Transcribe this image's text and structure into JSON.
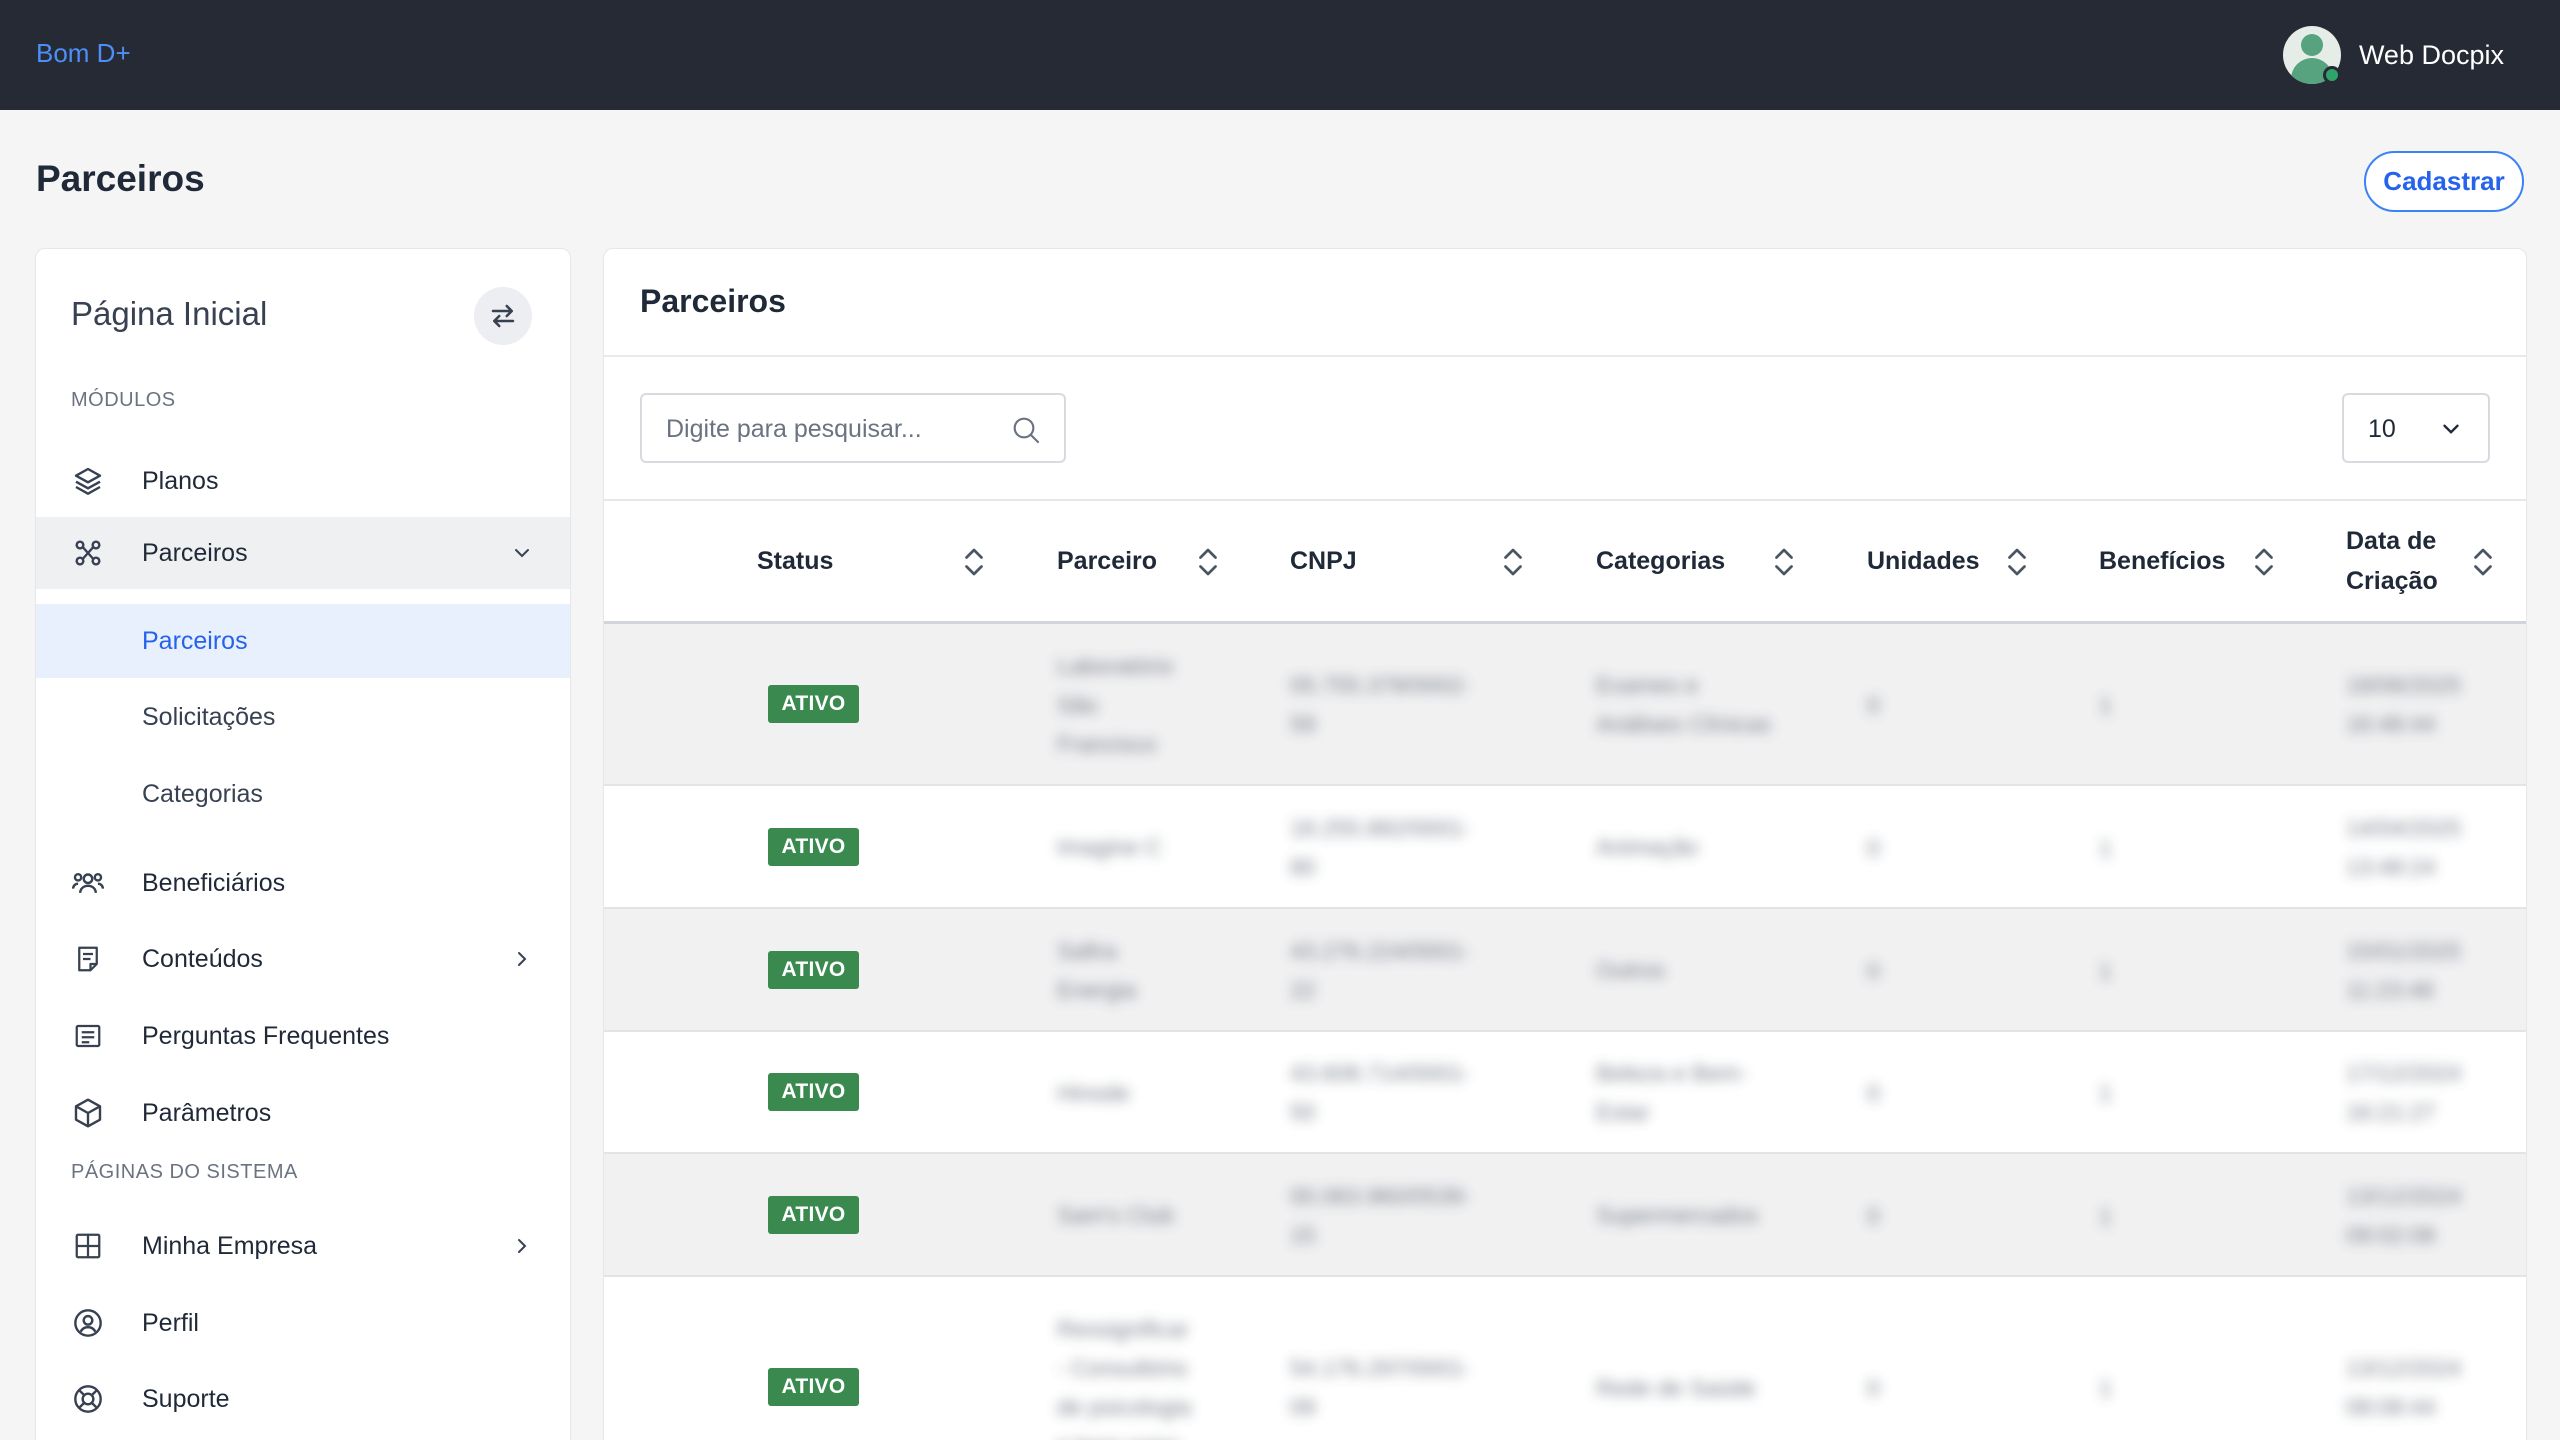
{
  "topbar": {
    "brand": "Bom D+",
    "user_name": "Web Docpix"
  },
  "page": {
    "title": "Parceiros",
    "cadastrar_label": "Cadastrar"
  },
  "sidebar": {
    "title": "Página Inicial",
    "section_modules": "MÓDULOS",
    "section_system": "PÁGINAS DO SISTEMA",
    "items": {
      "planos": "Planos",
      "parceiros": "Parceiros",
      "sub_parceiros": "Parceiros",
      "sub_solicitacoes": "Solicitações",
      "sub_categorias": "Categorias",
      "beneficiarios": "Beneficiários",
      "conteudos": "Conteúdos",
      "perguntas": "Perguntas Frequentes",
      "parametros": "Parâmetros",
      "minha_empresa": "Minha Empresa",
      "perfil": "Perfil",
      "suporte": "Suporte"
    }
  },
  "card": {
    "title": "Parceiros",
    "search_placeholder": "Digite para pesquisar...",
    "per_page": "10"
  },
  "table": {
    "headers": {
      "status": "Status",
      "parceiro": "Parceiro",
      "cnpj": "CNPJ",
      "categorias": "Categorias",
      "unidades": "Unidades",
      "beneficios": "Benefícios",
      "data_l1": "Data de",
      "data_l2": "Criação"
    },
    "rows": [
      {
        "status": "ATIVO",
        "parceiro": [
          "Laboratório",
          "São",
          "Francisco"
        ],
        "cnpj": [
          "05.755.378/0002-",
          "59"
        ],
        "categorias": [
          "Exames e",
          "Análises Clínicas"
        ],
        "unidades": "0",
        "beneficios": "1",
        "data": [
          "18/06/2025",
          "16:48:44"
        ]
      },
      {
        "status": "ATIVO",
        "parceiro": [
          "Imagine C"
        ],
        "cnpj": [
          "18.255.882/0001-",
          "80"
        ],
        "categorias": [
          "Animação"
        ],
        "unidades": "0",
        "beneficios": "1",
        "data": [
          "14/04/2025",
          "13:48:24"
        ]
      },
      {
        "status": "ATIVO",
        "parceiro": [
          "Safira",
          "Energia"
        ],
        "cnpj": [
          "43.276.224/0001-",
          "22"
        ],
        "categorias": [
          "Outros"
        ],
        "unidades": "0",
        "beneficios": "1",
        "data": [
          "15/01/2025",
          "11:23:48"
        ]
      },
      {
        "status": "ATIVO",
        "parceiro": [
          "Hinode"
        ],
        "cnpj": [
          "43.608.714/0001-",
          "50"
        ],
        "categorias": [
          "Beleza e Bem-",
          "Estar"
        ],
        "unidades": "0",
        "beneficios": "1",
        "data": [
          "17/12/2024",
          "16:21:27"
        ]
      },
      {
        "status": "ATIVO",
        "parceiro": [
          "Sam's Club"
        ],
        "cnpj": [
          "00.063.960/0539-",
          "15"
        ],
        "categorias": [
          "Supermercados"
        ],
        "unidades": "0",
        "beneficios": "1",
        "data": [
          "13/12/2024",
          "09:02:08"
        ]
      },
      {
        "status": "ATIVO",
        "parceiro": [
          "Ressignificar",
          "- Consultório",
          "de psicologia",
          "e bem-estar"
        ],
        "cnpj": [
          "54.176.297/0001-",
          "09"
        ],
        "categorias": [
          "Rede de Saúde"
        ],
        "unidades": "0",
        "beneficios": "1",
        "data": [
          "13/12/2024",
          "08:08:44"
        ]
      }
    ]
  },
  "colors": {
    "topbar_bg": "#262a34",
    "brand": "#4d8ef7",
    "accent": "#2563eb",
    "status_active": "#3a8a4f"
  }
}
